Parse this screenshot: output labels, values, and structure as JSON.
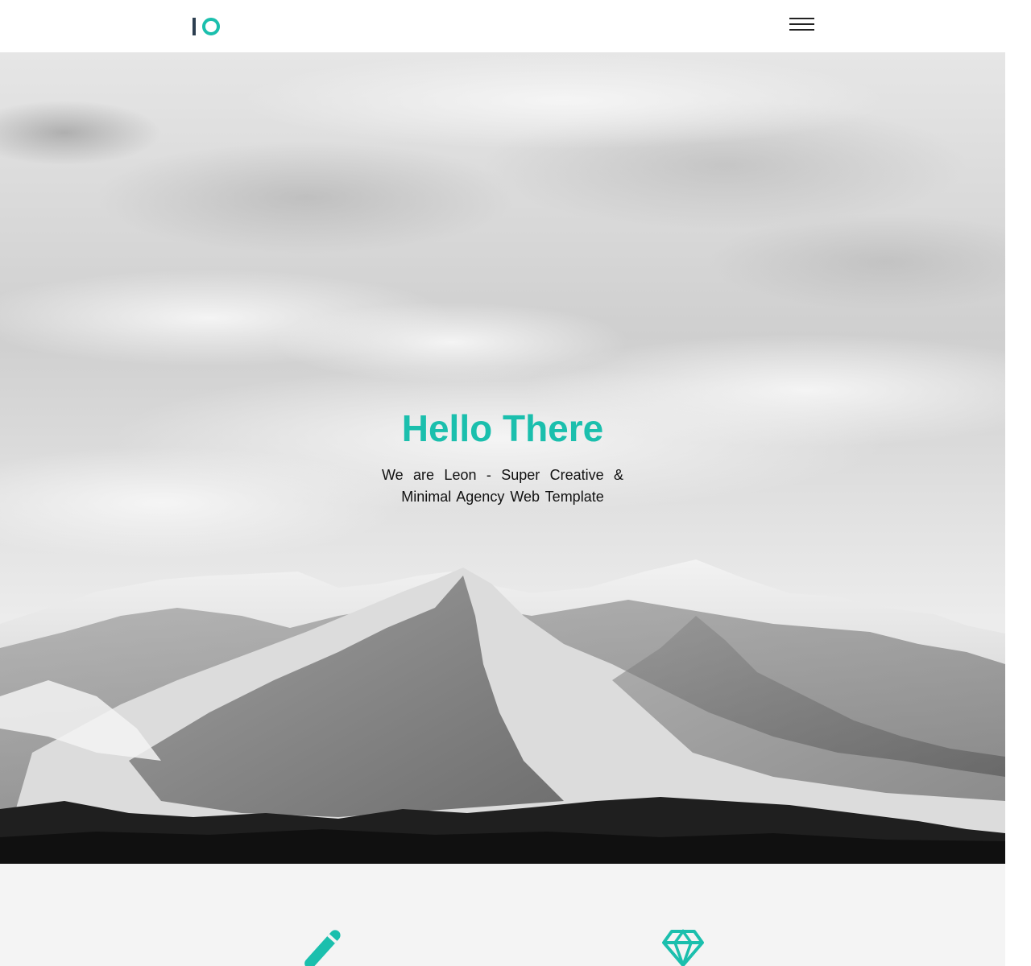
{
  "header": {
    "logo_icon": "io-logo-icon",
    "menu_icon": "hamburger-menu-icon"
  },
  "hero": {
    "title": "Hello There",
    "subtitle": "We are Leon - Super Creative & Minimal Agency Web Template",
    "background": "mountain-landscape-image"
  },
  "features": {
    "items": [
      {
        "icon": "pencil-icon"
      },
      {
        "icon": "diamond-icon"
      }
    ]
  },
  "colors": {
    "accent": "#1bbfad",
    "logo_dark": "#2c3e50",
    "features_bg": "#f4f4f4"
  }
}
